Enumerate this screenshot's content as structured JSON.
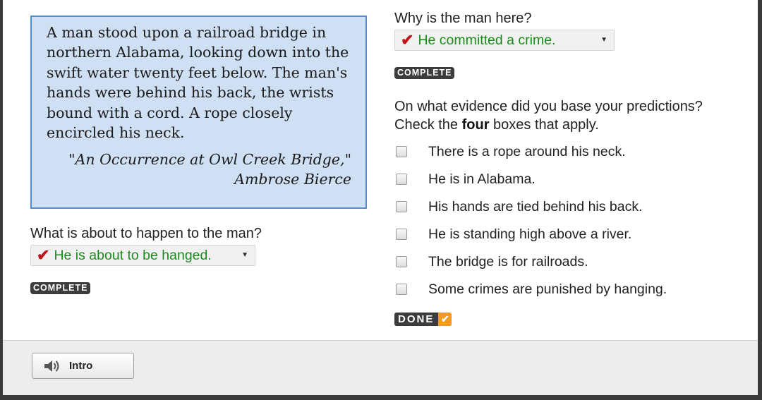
{
  "passage": {
    "text": "A man stood upon a railroad bridge in northern Alabama, looking down into the swift water twenty feet below. The man's hands were behind his back, the wrists bound with a cord. A rope closely encircled his neck.",
    "citation_title": "\"An Occurrence at Owl Creek Bridge,\"",
    "citation_author": "Ambrose Bierce"
  },
  "question1": {
    "label": "What is about to happen to the man?",
    "selected": "He is about to be hanged.",
    "status": "COMPLETE"
  },
  "question2": {
    "label": "Why is the man here?",
    "selected": "He committed a crime.",
    "status": "COMPLETE"
  },
  "evidence": {
    "prompt_before": "On what evidence did you base your predictions? Check the ",
    "prompt_bold": "four",
    "prompt_after": " boxes that apply.",
    "options": [
      {
        "label": "There is a rope around his neck.",
        "checked": false
      },
      {
        "label": "He is in Alabama.",
        "checked": false
      },
      {
        "label": "His hands are tied behind his back.",
        "checked": false
      },
      {
        "label": "He is standing high above a river.",
        "checked": false
      },
      {
        "label": "The bridge is for railroads.",
        "checked": false
      },
      {
        "label": "Some crimes are punished by hanging.",
        "checked": false
      }
    ],
    "done_label": "DONE"
  },
  "footer": {
    "intro_label": "Intro",
    "intro_icon": "speaker-icon"
  },
  "colors": {
    "selected_text": "#1c8a1c",
    "checkmark": "#c0151b",
    "passage_bg": "#cfe0f4",
    "passage_border": "#4d8fd6",
    "done_check_bg": "#f39a1f"
  }
}
